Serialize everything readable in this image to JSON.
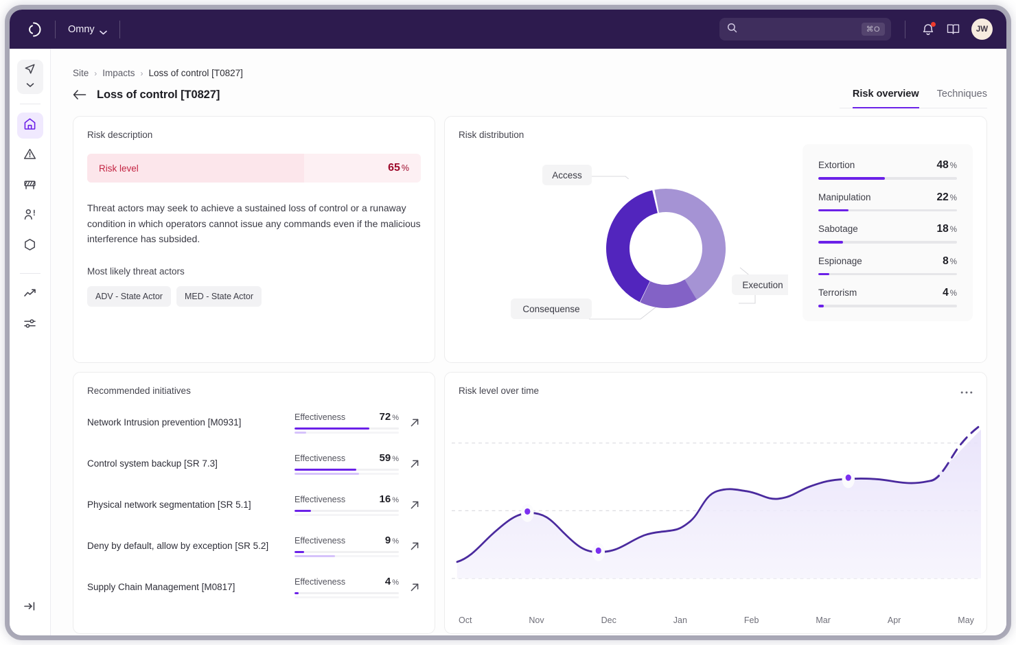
{
  "topbar": {
    "logo_icon": "omny-logo-icon",
    "org_name": "Omny",
    "org_chevron_icon": "chevron-down-icon",
    "search": {
      "icon": "search-icon",
      "placeholder": "",
      "value": "",
      "shortcut": "⌘O"
    },
    "notifications_icon": "bell-icon",
    "docs_icon": "book-icon",
    "avatar_initials": "JW"
  },
  "sidebar": {
    "nav_icon": "navigation-arrow-icon",
    "nav_chevron_icon": "chevron-down-icon",
    "items": [
      {
        "icon": "home-icon",
        "name": "sidebar-item-home",
        "active": true
      },
      {
        "icon": "alert-triangle-icon",
        "name": "sidebar-item-alerts",
        "active": false
      },
      {
        "icon": "barrier-icon",
        "name": "sidebar-item-barriers",
        "active": false
      },
      {
        "icon": "user-alert-icon",
        "name": "sidebar-item-actors",
        "active": false
      },
      {
        "icon": "hexagon-icon",
        "name": "sidebar-item-assets",
        "active": false
      },
      {
        "icon": "trending-up-icon",
        "name": "sidebar-item-trends",
        "active": false
      },
      {
        "icon": "sliders-icon",
        "name": "sidebar-item-settings",
        "active": false
      }
    ],
    "expand_icon": "expand-sidebar-icon"
  },
  "breadcrumb": {
    "items": [
      "Site",
      "Impacts",
      "Loss of control [T0827]"
    ],
    "separator": "›"
  },
  "page": {
    "back_icon": "arrow-left-icon",
    "title": "Loss of control [T0827]",
    "tabs": [
      {
        "label": "Risk overview",
        "active": true
      },
      {
        "label": "Techniques",
        "active": false
      }
    ]
  },
  "risk_description": {
    "card_title": "Risk description",
    "risk_level_label": "Risk level",
    "risk_level_value": "65",
    "risk_level_unit": "%",
    "risk_level_pct": 65,
    "description": "Threat actors may seek to achieve a sustained loss of control or a runaway condition in which operators cannot issue any commands even if the malicious interference has subsided.",
    "threat_actors_title": "Most likely threat actors",
    "threat_actors": [
      "ADV - State Actor",
      "MED - State Actor"
    ]
  },
  "risk_distribution": {
    "card_title": "Risk distribution",
    "chart_data": {
      "type": "pie",
      "title": "Risk distribution",
      "categories": [
        "Access",
        "Execution",
        "Consequense"
      ],
      "values": [
        44,
        16,
        40
      ],
      "colors": [
        "#a593d4",
        "#8362c6",
        "#5225bd"
      ],
      "legend_position": "right"
    },
    "legend": {
      "rows": [
        {
          "label": "Extortion",
          "value": "48",
          "unit": "%",
          "pct": 48
        },
        {
          "label": "Manipulation",
          "value": "22",
          "unit": "%",
          "pct": 22
        },
        {
          "label": "Sabotage",
          "value": "18",
          "unit": "%",
          "pct": 18
        },
        {
          "label": "Espionage",
          "value": "8",
          "unit": "%",
          "pct": 8
        },
        {
          "label": "Terrorism",
          "value": "4",
          "unit": "%",
          "pct": 4
        }
      ]
    }
  },
  "initiatives": {
    "card_title": "Recommended initiatives",
    "meter_label": "Effectiveness",
    "open_icon": "arrow-up-right-icon",
    "rows": [
      {
        "name": "Network Intrusion prevention [M0931]",
        "value": "72",
        "unit": "%",
        "pct": 72,
        "pct2": 11
      },
      {
        "name": "Control system backup [SR 7.3]",
        "value": "59",
        "unit": "%",
        "pct": 59,
        "pct2": 62
      },
      {
        "name": "Physical network segmentation [SR 5.1]",
        "value": "16",
        "unit": "%",
        "pct": 16,
        "pct2": 0
      },
      {
        "name": "Deny by default, allow by exception [SR 5.2]",
        "value": "9",
        "unit": "%",
        "pct": 9,
        "pct2": 39
      },
      {
        "name": "Supply Chain Management [M0817]",
        "value": "4",
        "unit": "%",
        "pct": 4,
        "pct2": 0
      }
    ]
  },
  "risk_over_time": {
    "card_title": "Risk level over time",
    "menu_icon": "more-horizontal-icon",
    "chart_data": {
      "type": "line",
      "title": "Risk level over time",
      "xlabel": "",
      "ylabel": "",
      "x": [
        "Oct",
        "Nov",
        "Dec",
        "Jan",
        "Feb",
        "Mar",
        "Apr",
        "May"
      ],
      "tick_labels": [
        "Oct",
        "Nov",
        "Dec",
        "Jan",
        "Feb",
        "Mar",
        "Apr",
        "May"
      ],
      "series": [
        {
          "name": "Risk level",
          "values": [
            18,
            42,
            26,
            47,
            64,
            70,
            74,
            96
          ],
          "color": "#4a2a9e"
        }
      ],
      "markers": [
        {
          "x": "Nov",
          "y": 42
        },
        {
          "x": "Dec",
          "y": 26
        },
        {
          "x": "Mar",
          "y": 70
        }
      ],
      "projection_from": "Apr",
      "projection_style": "dashed",
      "grid": true,
      "gridlines": [
        0,
        40,
        80
      ],
      "ylim": [
        0,
        100
      ],
      "area_fill": "#efebfb"
    }
  },
  "colors": {
    "brand_purple": "#6b21e8",
    "header_bg": "#2d1b4e",
    "risk_red": "#9e0b2c",
    "donut_light": "#a593d4",
    "donut_mid": "#8362c6",
    "donut_dark": "#5225bd"
  }
}
